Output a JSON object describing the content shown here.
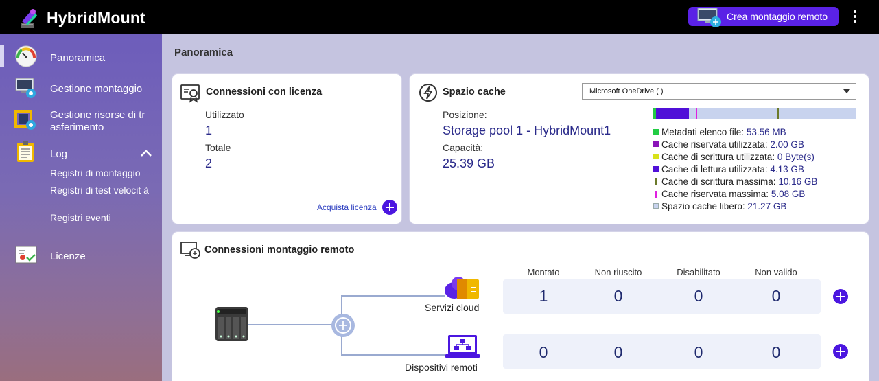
{
  "app": {
    "title": "HybridMount",
    "create_button": "Crea montaggio remoto"
  },
  "sidebar": {
    "items": [
      {
        "label": "Panoramica",
        "icon": "gauge-icon"
      },
      {
        "label": "Gestione montaggio",
        "icon": "monitor-gear-icon"
      },
      {
        "label": "Gestione risorse di tr asferimento",
        "icon": "resource-gear-icon"
      },
      {
        "label": "Log",
        "icon": "clipboard-icon"
      },
      {
        "label": "Licenze",
        "icon": "certificate-icon"
      }
    ],
    "log_sub": [
      "Registri di montaggio",
      "Registri di test velocit à",
      "Registri eventi"
    ]
  },
  "page": {
    "title": "Panoramica"
  },
  "license": {
    "title": "Connessioni con licenza",
    "used_label": "Utilizzato",
    "used_value": "1",
    "total_label": "Totale",
    "total_value": "2",
    "buy_link": "Acquista licenza"
  },
  "cache": {
    "title": "Spazio cache",
    "selected": "Microsoft OneDrive (                              )",
    "position_label": "Posizione:",
    "position_value": "Storage pool 1 - HybridMount1",
    "capacity_label": "Capacità:",
    "capacity_value": "25.39 GB",
    "legend": [
      {
        "label": "Metadati elenco file:",
        "value": "53.56 MB",
        "color": "#22cc44"
      },
      {
        "label": "Cache riservata utilizzata:",
        "value": "2.00 GB",
        "color": "#8a14b8"
      },
      {
        "label": "Cache di scrittura utilizzata:",
        "value": "0 Byte(s)",
        "color": "#d8e21a"
      },
      {
        "label": "Cache di lettura utilizzata:",
        "value": "4.13 GB",
        "color": "#5010d8"
      },
      {
        "label": "Cache di scrittura massima:",
        "value": "10.16 GB",
        "color": "#6b7a2a"
      },
      {
        "label": "Cache riservata massima:",
        "value": "5.08 GB",
        "color": "#e020e0"
      },
      {
        "label": "Spazio cache libero:",
        "value": "21.27 GB",
        "color": "#c8d3ee"
      }
    ]
  },
  "remote": {
    "title": "Connessioni montaggio remoto",
    "headers": [
      "Montato",
      "Non riuscito",
      "Disabilitato",
      "Non valido"
    ],
    "cloud_label": "Servizi cloud",
    "device_label": "Dispositivi remoti",
    "cloud_stats": [
      "1",
      "0",
      "0",
      "0"
    ],
    "device_stats": [
      "0",
      "0",
      "0",
      "0"
    ]
  }
}
